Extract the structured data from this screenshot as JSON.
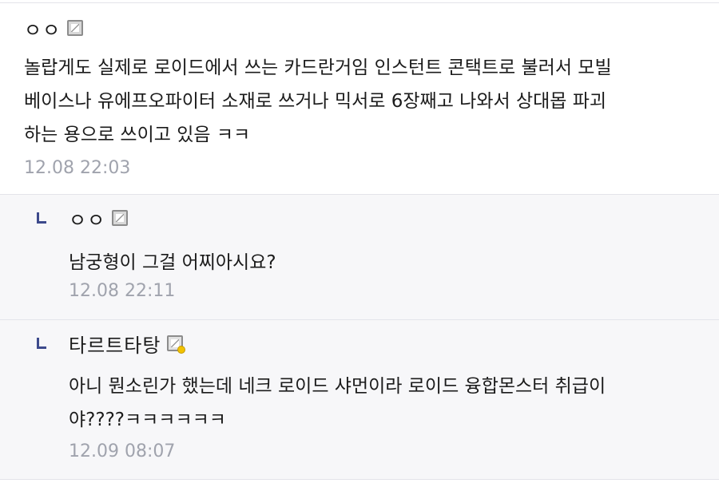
{
  "comments": [
    {
      "author": "ㅇㅇ",
      "badge_icon": "gallery-member-badge-icon",
      "lines": [
        "놀랍게도 실제로 로이드에서 쓰는 카드란거임 인스턴트 콘택트로 불러서 모빌",
        "베이스나 유에프오파이터 소재로 쓰거나 믹서로 6장째고 나와서 상대몹 파괴",
        "하는 용으로 쓰이고 있음 ㅋㅋ"
      ],
      "timestamp": "12.08 22:03"
    }
  ],
  "replies": [
    {
      "author": "ㅇㅇ",
      "badge_icon": "gallery-member-badge-icon",
      "lines": [
        "남궁형이 그걸 어찌아시요?"
      ],
      "timestamp": "12.08 22:11"
    },
    {
      "author": "타르트타탕",
      "badge_icon": "fixed-nick-badge-icon",
      "lines": [
        "아니 뭔소린가 했는데 네크 로이드 샤먼이라 로이드 융합몬스터 취급이",
        "야????ㅋㅋㅋㅋㅋㅋ"
      ],
      "timestamp": "12.09 08:07"
    }
  ],
  "colors": {
    "reply_background": "#f7f7f9",
    "divider": "#e3e4ea",
    "timestamp": "#a0a3ad",
    "reply_arrow": "#3d4a8c"
  }
}
